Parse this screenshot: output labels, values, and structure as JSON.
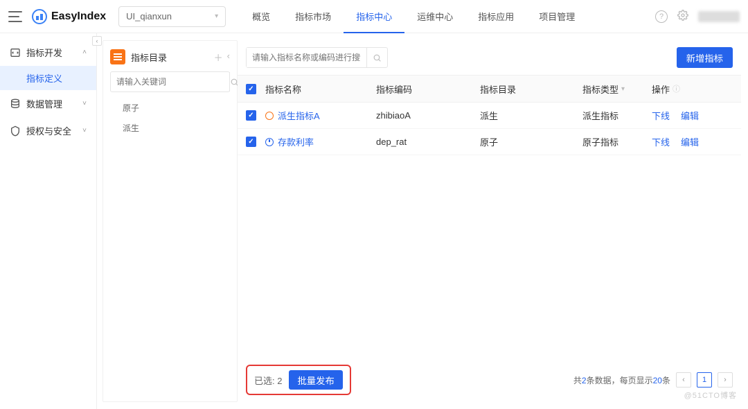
{
  "brand": {
    "name": "EasyIndex"
  },
  "project_select": {
    "value": "UI_qianxun"
  },
  "nav": {
    "items": [
      {
        "label": "概览"
      },
      {
        "label": "指标市场"
      },
      {
        "label": "指标中心"
      },
      {
        "label": "运维中心"
      },
      {
        "label": "指标应用"
      },
      {
        "label": "项目管理"
      }
    ],
    "active_index": 2
  },
  "sidebar": {
    "sections": [
      {
        "label": "指标开发",
        "expanded": true,
        "children": [
          {
            "label": "指标定义",
            "active": true
          }
        ]
      },
      {
        "label": "数据管理",
        "expanded": false
      },
      {
        "label": "授权与安全",
        "expanded": false
      }
    ]
  },
  "tree": {
    "title": "指标目录",
    "search_placeholder": "请输入关键词",
    "items": [
      {
        "label": "原子"
      },
      {
        "label": "派生"
      }
    ]
  },
  "toolbar": {
    "search_placeholder": "请输入指标名称或编码进行搜索",
    "add_button": "新增指标"
  },
  "table": {
    "columns": {
      "name": "指标名称",
      "code": "指标编码",
      "dir": "指标目录",
      "type": "指标类型",
      "ops": "操作"
    },
    "rows": [
      {
        "checked": true,
        "status": "orange",
        "name": "派生指标A",
        "code": "zhibiaoA",
        "dir": "派生",
        "type": "派生指标"
      },
      {
        "checked": true,
        "status": "blue",
        "name": "存款利率",
        "code": "dep_rat",
        "dir": "原子",
        "type": "原子指标"
      }
    ],
    "ops": {
      "offline": "下线",
      "edit": "编辑"
    }
  },
  "footer": {
    "selected_label": "已选:",
    "selected_count": "2",
    "batch_publish": "批量发布",
    "total_prefix": "共",
    "total_count": "2",
    "total_suffix": "条数据，每页显示",
    "page_size": "20",
    "total_tail": "条",
    "current_page": "1"
  },
  "watermark": "@51CTO博客"
}
